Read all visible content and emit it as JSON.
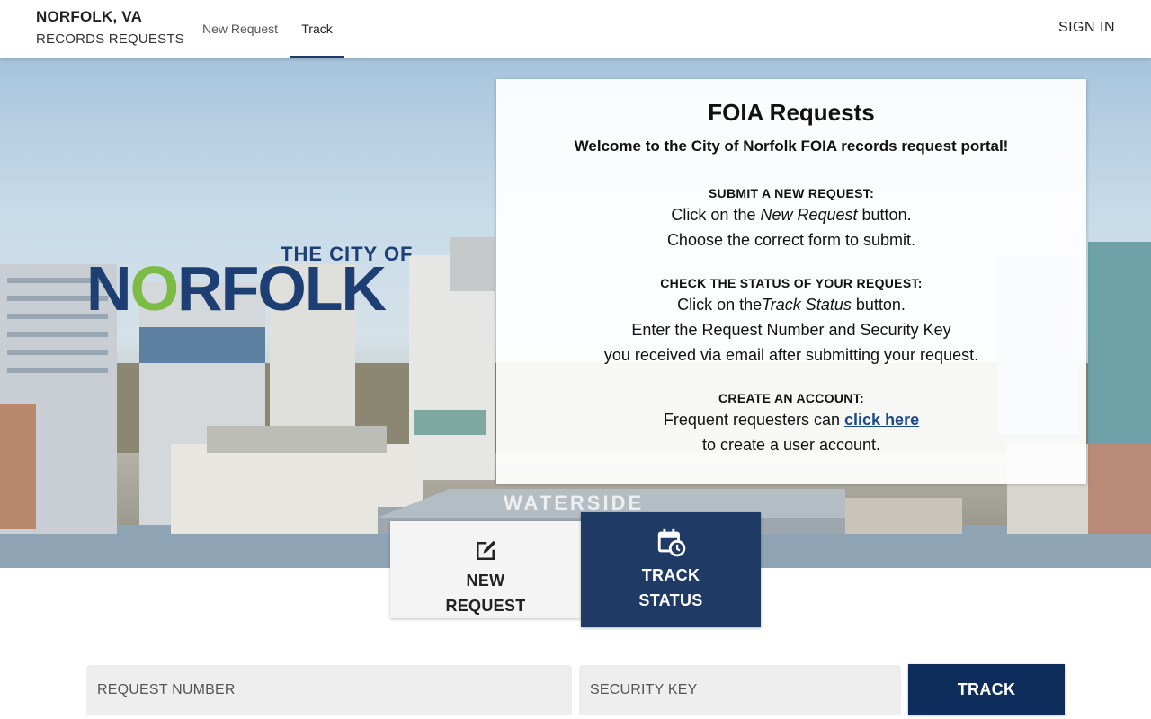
{
  "header": {
    "brand_line1": "NORFOLK, VA",
    "brand_line2": "RECORDS REQUESTS",
    "tabs": [
      {
        "label": "New Request"
      },
      {
        "label": "Track"
      }
    ],
    "active_tab": "Track",
    "sign_in_label": "SIGN IN"
  },
  "hero": {
    "logo_top": "THE CITY OF",
    "logo_main_before": "N",
    "logo_main_o": "O",
    "logo_main_after": "RFOLK"
  },
  "card": {
    "title": "FOIA Requests",
    "welcome": "Welcome to the City of Norfolk FOIA records request portal!",
    "submit": {
      "heading": "SUBMIT A NEW REQUEST:",
      "line1_pre": "Click on the ",
      "line1_em": "New Request",
      "line1_post": " button.",
      "line2": "Choose the correct form to submit."
    },
    "check": {
      "heading": "CHECK THE STATUS OF YOUR REQUEST:",
      "line1_pre": "Click on the",
      "line1_em": "Track Status",
      "line1_post": " button.",
      "line2": "Enter the Request Number and Security Key",
      "line3": "you received via email after submitting your request."
    },
    "account": {
      "heading": "CREATE AN ACCOUNT:",
      "line1_pre": "Frequent requesters can ",
      "link": "click here",
      "line2": "to create a user account."
    }
  },
  "options": {
    "new_request": {
      "line1": "NEW",
      "line2": "REQUEST",
      "icon": "edit-icon"
    },
    "track_status": {
      "line1": "TRACK",
      "line2": "STATUS",
      "icon": "calendar-clock-icon"
    }
  },
  "track_form": {
    "request_number_placeholder": "REQUEST NUMBER",
    "request_number_value": "",
    "security_key_placeholder": "SECURITY KEY",
    "security_key_value": "",
    "track_label": "TRACK"
  },
  "colors": {
    "primary_navy": "#1f3a64",
    "button_navy": "#0f2d5c",
    "logo_blue": "#1d3f73",
    "logo_green": "#7cbb44",
    "link_blue": "#1a4a8c"
  }
}
